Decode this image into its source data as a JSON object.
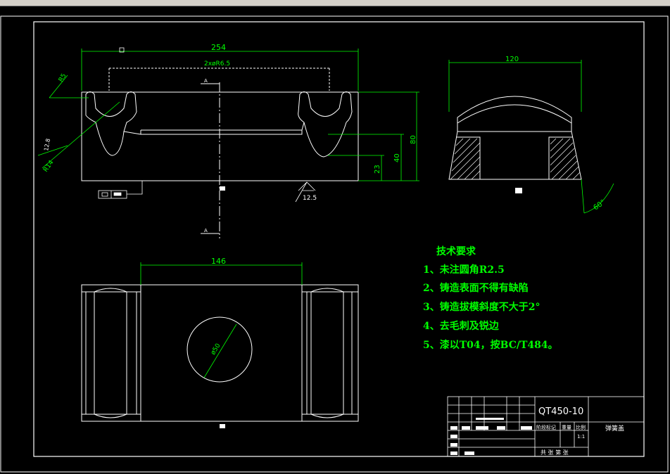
{
  "drawing": {
    "front_view": {
      "overall_width": "254",
      "slot_spacing": "2xøR6.5",
      "fillet": "R5",
      "chamfer_a": "12.8",
      "chamfer_b": "R14",
      "height_total": "80",
      "height_mid": "40",
      "height_low": "23",
      "roughness": "12.5"
    },
    "side_view": {
      "width": "120",
      "angle": "60°"
    },
    "top_view": {
      "width": "146",
      "hole": "ø50"
    },
    "technical_requirements": {
      "title": "技术要求",
      "items": [
        "1、未注圆角R2.5",
        "2、铸造表面不得有缺陷",
        "3、铸造拔模斜度不大于2°",
        "4、去毛刺及锐边",
        "5、漆以T04，按BC/T484。"
      ]
    },
    "title_block": {
      "material": "QT450-10",
      "part_name": "弹簧盖",
      "scale": "1:1",
      "stage_label": "阶段标记",
      "weight_label": "重量",
      "scale_label": "比例",
      "sheets_label": "共  张   第  张"
    },
    "colors": {
      "line": "#ffffff",
      "dimension": "#00ff00",
      "background": "#000000"
    }
  }
}
